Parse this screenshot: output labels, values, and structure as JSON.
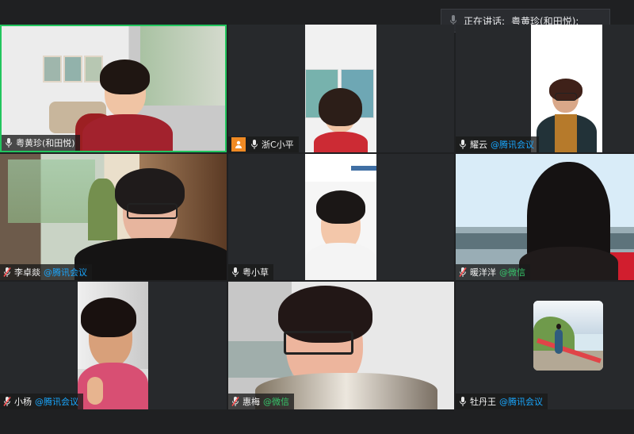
{
  "speaking_banner": {
    "prefix": "正在讲话:",
    "name": "粤黄珍(和田悦);"
  },
  "participants": [
    {
      "name": "粤黄珍(和田悦)",
      "suffix": ""
    },
    {
      "name": "浙C小平",
      "suffix": ""
    },
    {
      "name": "耀云",
      "suffix": "@腾讯会议"
    },
    {
      "name": "李卓燚",
      "suffix": "@腾讯会议"
    },
    {
      "name": "粤小草",
      "suffix": ""
    },
    {
      "name": "暖洋洋",
      "suffix": "@微信"
    },
    {
      "name": "小杨",
      "suffix": "@腾讯会议"
    },
    {
      "name": "惠梅",
      "suffix": "@微信"
    },
    {
      "name": "牡丹王",
      "suffix": "@腾讯会议"
    }
  ],
  "colors": {
    "active_border": "#22c55e",
    "tencent_suffix": "#19a7ff",
    "wechat_suffix": "#36c56a"
  }
}
